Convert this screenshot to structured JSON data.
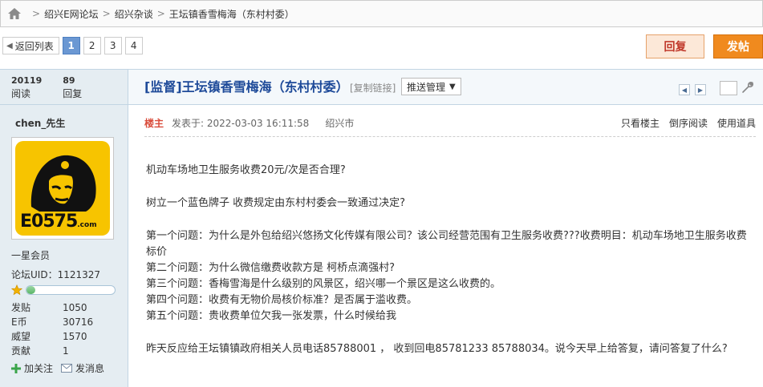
{
  "breadcrumb": {
    "items": [
      "绍兴E网论坛",
      "绍兴杂谈",
      "王坛镇香雪梅海（东村村委）"
    ],
    "separator": ">"
  },
  "pager": {
    "back_label": "返回列表",
    "pages": [
      "1",
      "2",
      "3",
      "4"
    ],
    "current": "1"
  },
  "actions": {
    "reply_label": "回复",
    "post_label": "发帖"
  },
  "thread": {
    "views": "20119",
    "views_label": "阅读",
    "replies": "89",
    "replies_label": "回复",
    "title": "[监督]王坛镇香雪梅海（东村村委）",
    "copy_link": "[复制链接]",
    "push_label": "推送管理"
  },
  "author": {
    "name": "chen_先生",
    "avatar_text": "E0575",
    "avatar_suffix": ".com",
    "rank": "一星会员",
    "uid_label": "论坛UID：",
    "uid": "1121327",
    "level_progress": 0.1,
    "stats": [
      {
        "label": "发贴",
        "value": "1050"
      },
      {
        "label": "E币",
        "value": "30716"
      },
      {
        "label": "威望",
        "value": "1570"
      },
      {
        "label": "贡献",
        "value": "1"
      }
    ],
    "follow_label": "加关注",
    "message_label": "发消息"
  },
  "post": {
    "author_tag": "楼主",
    "posted_at": "发表于: 2022-03-03 16:11:58",
    "location": "绍兴市",
    "tools": [
      "只看楼主",
      "倒序阅读",
      "使用道具"
    ],
    "lines": [
      "机动车场地卫生服务收费20元/次是否合理?",
      "",
      "树立一个蓝色牌子 收费规定由东村村委会一致通过决定?",
      "",
      "第一个问题：为什么是外包给绍兴悠扬文化传媒有限公司？该公司经营范围有卫生服务收费???收费明目：机动车场地卫生服务收费标价",
      "第二个问题：为什么微信缴费收款方是 柯桥点滴强村?",
      "第三个问题：香梅雪海是什么级别的风景区，绍兴哪一个景区是这么收费的。",
      "第四个问题：收费有无物价局核价标准？是否属于滥收费。",
      "第五个问题：贵收费单位欠我一张发票，什么时候给我",
      "",
      "昨天反应给王坛镇镇政府相关人员电话85788001 ， 收到回电85781233 85788034。说今天早上给答复，请问答复了什么?"
    ]
  }
}
